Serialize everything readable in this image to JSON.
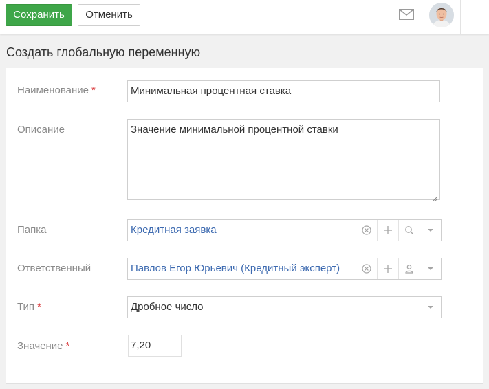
{
  "toolbar": {
    "save_label": "Сохранить",
    "cancel_label": "Отменить"
  },
  "page": {
    "title": "Создать глобальную переменную"
  },
  "form": {
    "name": {
      "label": "Наименование",
      "required_mark": "*",
      "value": "Минимальная процентная ставка"
    },
    "description": {
      "label": "Описание",
      "value": "Значение минимальной процентной ставки"
    },
    "folder": {
      "label": "Папка",
      "value": "Кредитная заявка"
    },
    "owner": {
      "label": "Ответственный",
      "value": "Павлов Егор Юрьевич (Кредитный эксперт)"
    },
    "type": {
      "label": "Тип",
      "required_mark": "*",
      "value": "Дробное число"
    },
    "value": {
      "label": "Значение",
      "required_mark": "*",
      "value": "7,20"
    }
  },
  "colors": {
    "accent_green": "#3ea649",
    "link_blue": "#3d6ab0",
    "required_red": "#d9383a",
    "label_gray": "#8a8a8a"
  },
  "icons": [
    "mail-icon",
    "clear-icon",
    "add-icon",
    "search-icon",
    "user-icon",
    "chevron-down-icon"
  ]
}
